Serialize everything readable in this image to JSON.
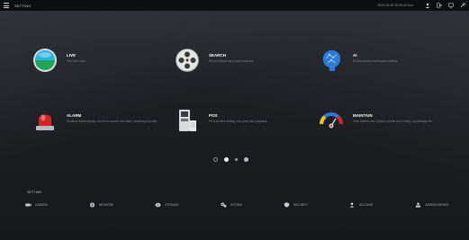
{
  "topbar": {
    "title": "SETTING",
    "datetime": "2023-05-28 15:35:40 Sun",
    "icons": [
      "menu-icon",
      "user-icon",
      "logout-icon",
      "display-icon",
      "tools-icon"
    ]
  },
  "tiles": [
    {
      "title": "LIVE",
      "desc": "View live video."
    },
    {
      "title": "SEARCH",
      "desc": "Record picture query and playback."
    },
    {
      "title": "AI",
      "desc": "AI video query and function setting."
    },
    {
      "title": "ALARM",
      "desc": "Realtime alarm display, event info search and alarm input/output config."
    },
    {
      "title": "POS",
      "desc": "POS function setting, info query and playback."
    },
    {
      "title": "MAINTAIN",
      "desc": "View System info, System update and Config, Log/Storage etc."
    }
  ],
  "pager": {
    "current": 2,
    "total": 4
  },
  "settings": {
    "label": "SETTING",
    "items": [
      {
        "label": "CAMERA",
        "icon": "camera-icon"
      },
      {
        "label": "NETWORK",
        "icon": "network-icon"
      },
      {
        "label": "STORAGE",
        "icon": "storage-icon"
      },
      {
        "label": "SYSTEM",
        "icon": "system-icon"
      },
      {
        "label": "SECURITY",
        "icon": "security-icon"
      },
      {
        "label": "ACCOUNT",
        "icon": "account-icon"
      },
      {
        "label": "CAMERA SERIES",
        "icon": "camera-series-icon"
      }
    ]
  },
  "colors": {
    "accent": "#2b7bd8",
    "alarm": "#d62424",
    "live": "#1fa45a"
  }
}
